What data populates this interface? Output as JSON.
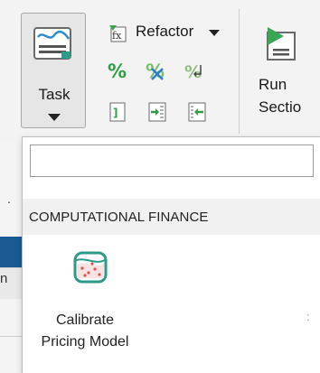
{
  "toolstrip": {
    "task_label": "Task",
    "refactor_label": "Refactor",
    "run_section_label": "Run\nSectio",
    "icons": [
      "task-icon",
      "refactor-icon",
      "percent-icon",
      "percent-clear-icon",
      "percent-wrap-icon",
      "comment-icon",
      "indent-icon",
      "outdent-icon",
      "run-section-icon"
    ]
  },
  "background": {
    "partial_letter": "n",
    "dot": "."
  },
  "dropdown": {
    "search_value": "",
    "category_header": "COMPUTATIONAL FINANCE",
    "items": [
      {
        "label": "Calibrate\nPricing Model",
        "icon": "calibrate-pricing-model-icon"
      }
    ],
    "trailing_mark": ":"
  },
  "colors": {
    "accent_blue": "#1b5a93",
    "icon_red": "#d9534f",
    "icon_teal": "#2e9a8a"
  }
}
